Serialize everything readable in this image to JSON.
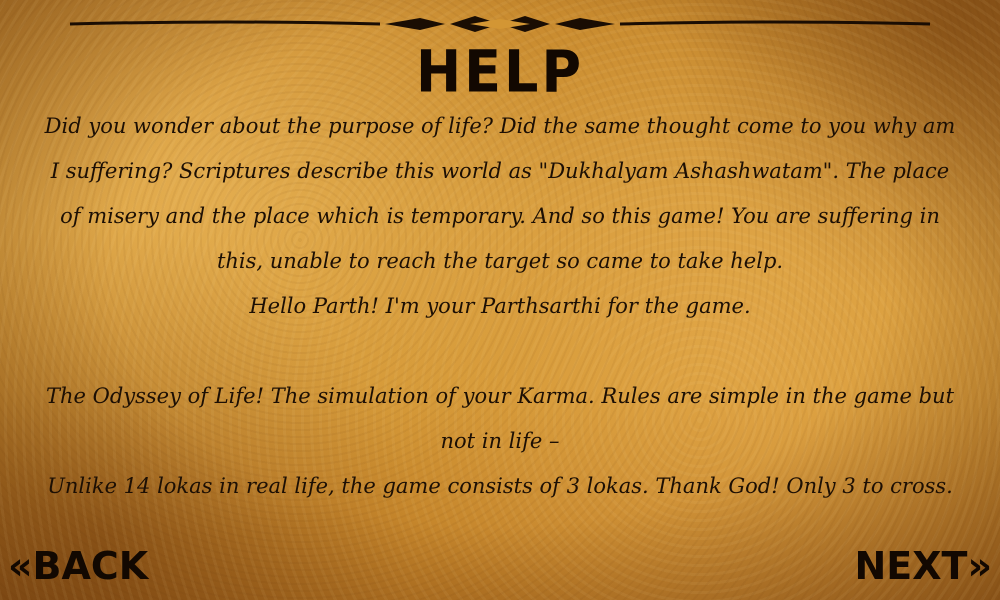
{
  "screen": {
    "title": "HELP",
    "paragraphs": [
      "Did you wonder about the purpose of life? Did the same thought come to you why am I suffering? Scriptures describe this world as \"Dukhalyam Ashashwatam\". The place of misery and the place which is temporary. And so this game! You are suffering in this, unable to reach the target so came to take help.",
      "Hello Parth! I'm your Parthsarthi for the game.",
      "The Odyssey of Life! The simulation of your Karma. Rules are simple in the game but not in life –",
      "Unlike 14 lokas in real life, the game consists of 3 lokas. Thank God! Only 3 to cross."
    ]
  },
  "nav": {
    "back_label": "«BACK",
    "next_label": "NEXT»"
  },
  "colors": {
    "parchment": "#d39634",
    "ink": "#120801"
  }
}
